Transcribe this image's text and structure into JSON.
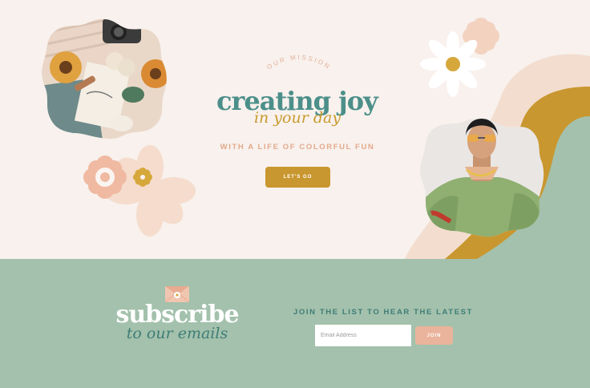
{
  "hero": {
    "mission_label": "OUR MISSION",
    "title": "creating joy",
    "subtitle": "in your day",
    "tagline": "WITH A LIFE OF COLORFUL FUN",
    "cta_label": "LET'S GO"
  },
  "subscribe": {
    "title": "subscribe",
    "subtitle": "to our emails",
    "join_text": "JOIN THE LIST TO HEAR THE LATEST",
    "email_placeholder": "Email Address",
    "join_label": "JOIN"
  },
  "colors": {
    "hero_bg": "#f8f1ed",
    "teal": "#4c8f8a",
    "mustard": "#c9972f",
    "peach": "#eab39b",
    "sage": "#a3c1ac"
  },
  "images": {
    "flatlay_photo": "flat-lay-photo-sunflowers-camera",
    "model_photo": "model-photo-sunglasses-green-shirt"
  }
}
